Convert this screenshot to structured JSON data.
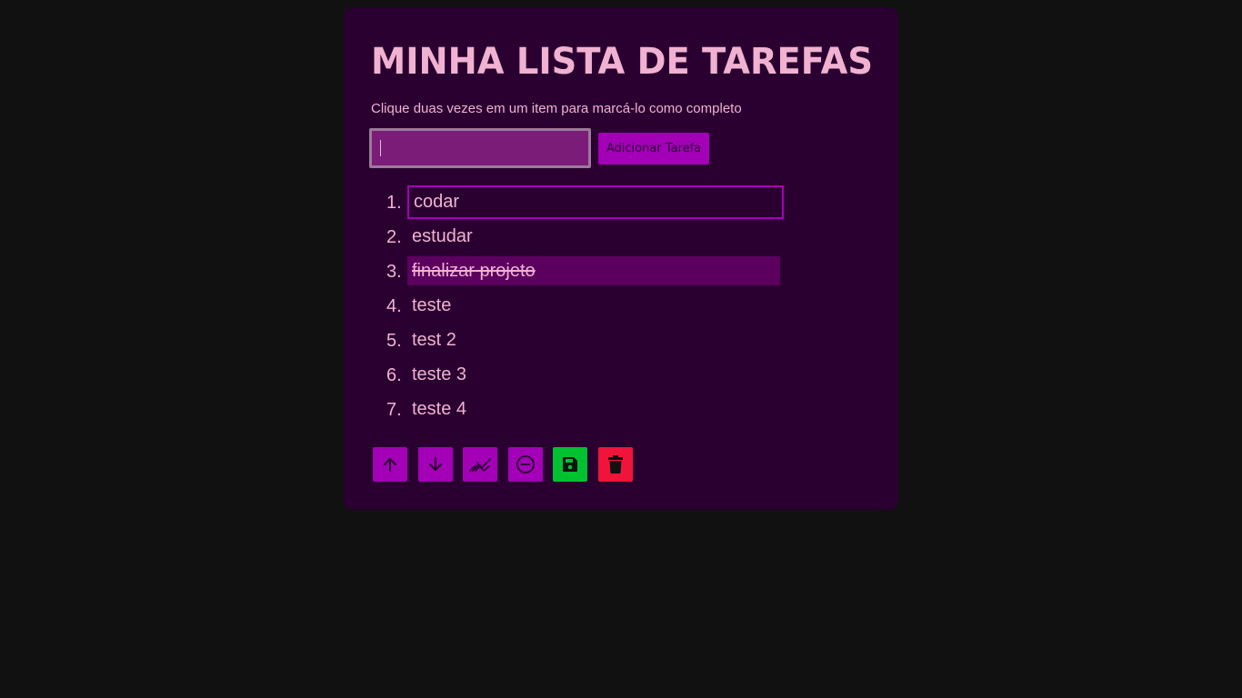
{
  "header": {
    "title": "MINHA LISTA DE TAREFAS",
    "subtitle": "Clique duas vezes em um item para marcá-lo como completo"
  },
  "form": {
    "input_value": "",
    "add_button_label": "Adicionar Tarefa"
  },
  "tasks": [
    {
      "number": "1.",
      "text": "codar",
      "state": "selected"
    },
    {
      "number": "2.",
      "text": "estudar",
      "state": "normal"
    },
    {
      "number": "3.",
      "text": "finalizar projeto",
      "state": "completed"
    },
    {
      "number": "4.",
      "text": "teste",
      "state": "normal"
    },
    {
      "number": "5.",
      "text": "test 2",
      "state": "normal"
    },
    {
      "number": "6.",
      "text": "teste 3",
      "state": "normal"
    },
    {
      "number": "7.",
      "text": "teste 4",
      "state": "normal"
    }
  ],
  "toolbar": {
    "buttons": [
      {
        "name": "move-up",
        "icon": "arrow-up-icon"
      },
      {
        "name": "move-down",
        "icon": "arrow-down-icon"
      },
      {
        "name": "clear-completed",
        "icon": "broom-icon"
      },
      {
        "name": "remove-selected",
        "icon": "minus-circle-icon"
      },
      {
        "name": "save",
        "icon": "floppy-disk-icon"
      },
      {
        "name": "delete-all",
        "icon": "trash-icon"
      }
    ]
  },
  "colors": {
    "page_background": "#111111",
    "card_background": "#2a0031",
    "text": "#f0b2d0",
    "accent": "#a300b8",
    "input_background": "#7b1d78",
    "completed_background": "#5b005f",
    "save_button": "#00c12f",
    "delete_button": "#f0143a"
  }
}
